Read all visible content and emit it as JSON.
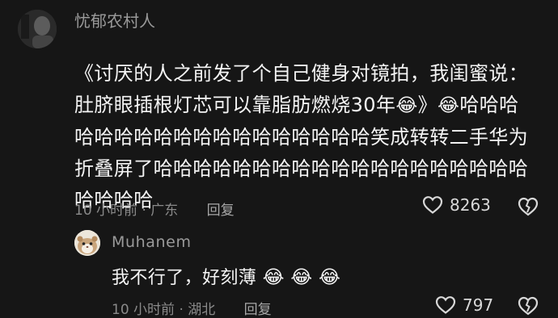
{
  "comment": {
    "username": "忧郁农村人",
    "text_part1": "《讨厌的人之前发了个自己健身对镜拍，我闺蜜说：肚脐眼插根灯芯可以靠脂肪燃烧30年",
    "emoji_1": "😂",
    "text_part2": "》",
    "emoji_2": "😂",
    "text_part3": "哈哈哈哈哈哈哈哈哈哈哈哈哈哈哈哈哈哈笑成转转二手华为折叠屏了哈哈哈哈哈哈哈哈哈哈哈哈哈哈哈哈哈哈哈哈哈哈哈",
    "time": "10 小时前",
    "location": "广东",
    "reply_label": "回复",
    "like_count": "8263"
  },
  "reply": {
    "username": "Muhanem",
    "text": "我不行了，好刻薄",
    "emojis": [
      "😂",
      "😂",
      "😂"
    ],
    "time": "10 小时前",
    "location": "湖北",
    "reply_label": "回复",
    "like_count": "797"
  }
}
